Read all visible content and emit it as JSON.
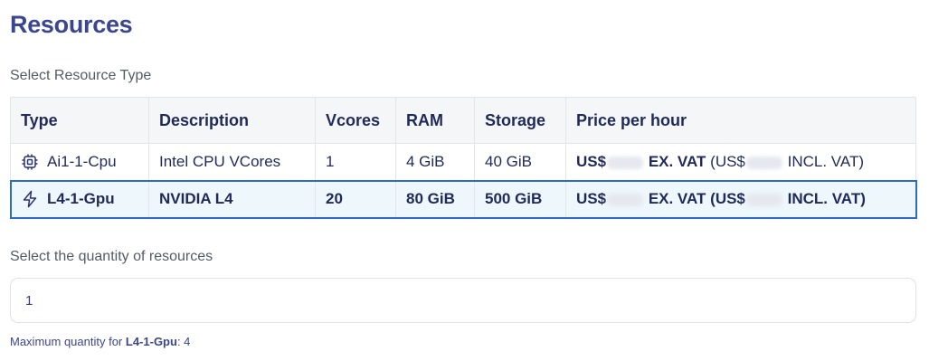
{
  "header": {
    "title": "Resources"
  },
  "resource_type": {
    "label": "Select Resource Type",
    "columns": [
      "Type",
      "Description",
      "Vcores",
      "RAM",
      "Storage",
      "Price per hour"
    ],
    "rows": [
      {
        "icon": "cpu-icon",
        "type": "Ai1-1-Cpu",
        "description": "Intel CPU VCores",
        "vcores": "1",
        "ram": "4 GiB",
        "storage": "40 GiB",
        "price_prefix": "US$",
        "price_ex_vat": "EX. VAT",
        "price_open": "(US$",
        "price_incl_vat": "INCL. VAT)",
        "selected": false
      },
      {
        "icon": "lightning-icon",
        "type": "L4-1-Gpu",
        "description": "NVIDIA L4",
        "vcores": "20",
        "ram": "80 GiB",
        "storage": "500 GiB",
        "price_prefix": "US$",
        "price_ex_vat": "EX. VAT",
        "price_open": "(US$",
        "price_incl_vat": "INCL. VAT)",
        "selected": true
      }
    ]
  },
  "quantity": {
    "label": "Select the quantity of resources",
    "value": "1",
    "max_prefix": "Maximum quantity for",
    "max_type": "L4-1-Gpu",
    "max_suffix": ": 4"
  },
  "colors": {
    "title": "#3b4690",
    "selected_border": "#2e6bc4",
    "selected_bg": "#eef7fc"
  }
}
